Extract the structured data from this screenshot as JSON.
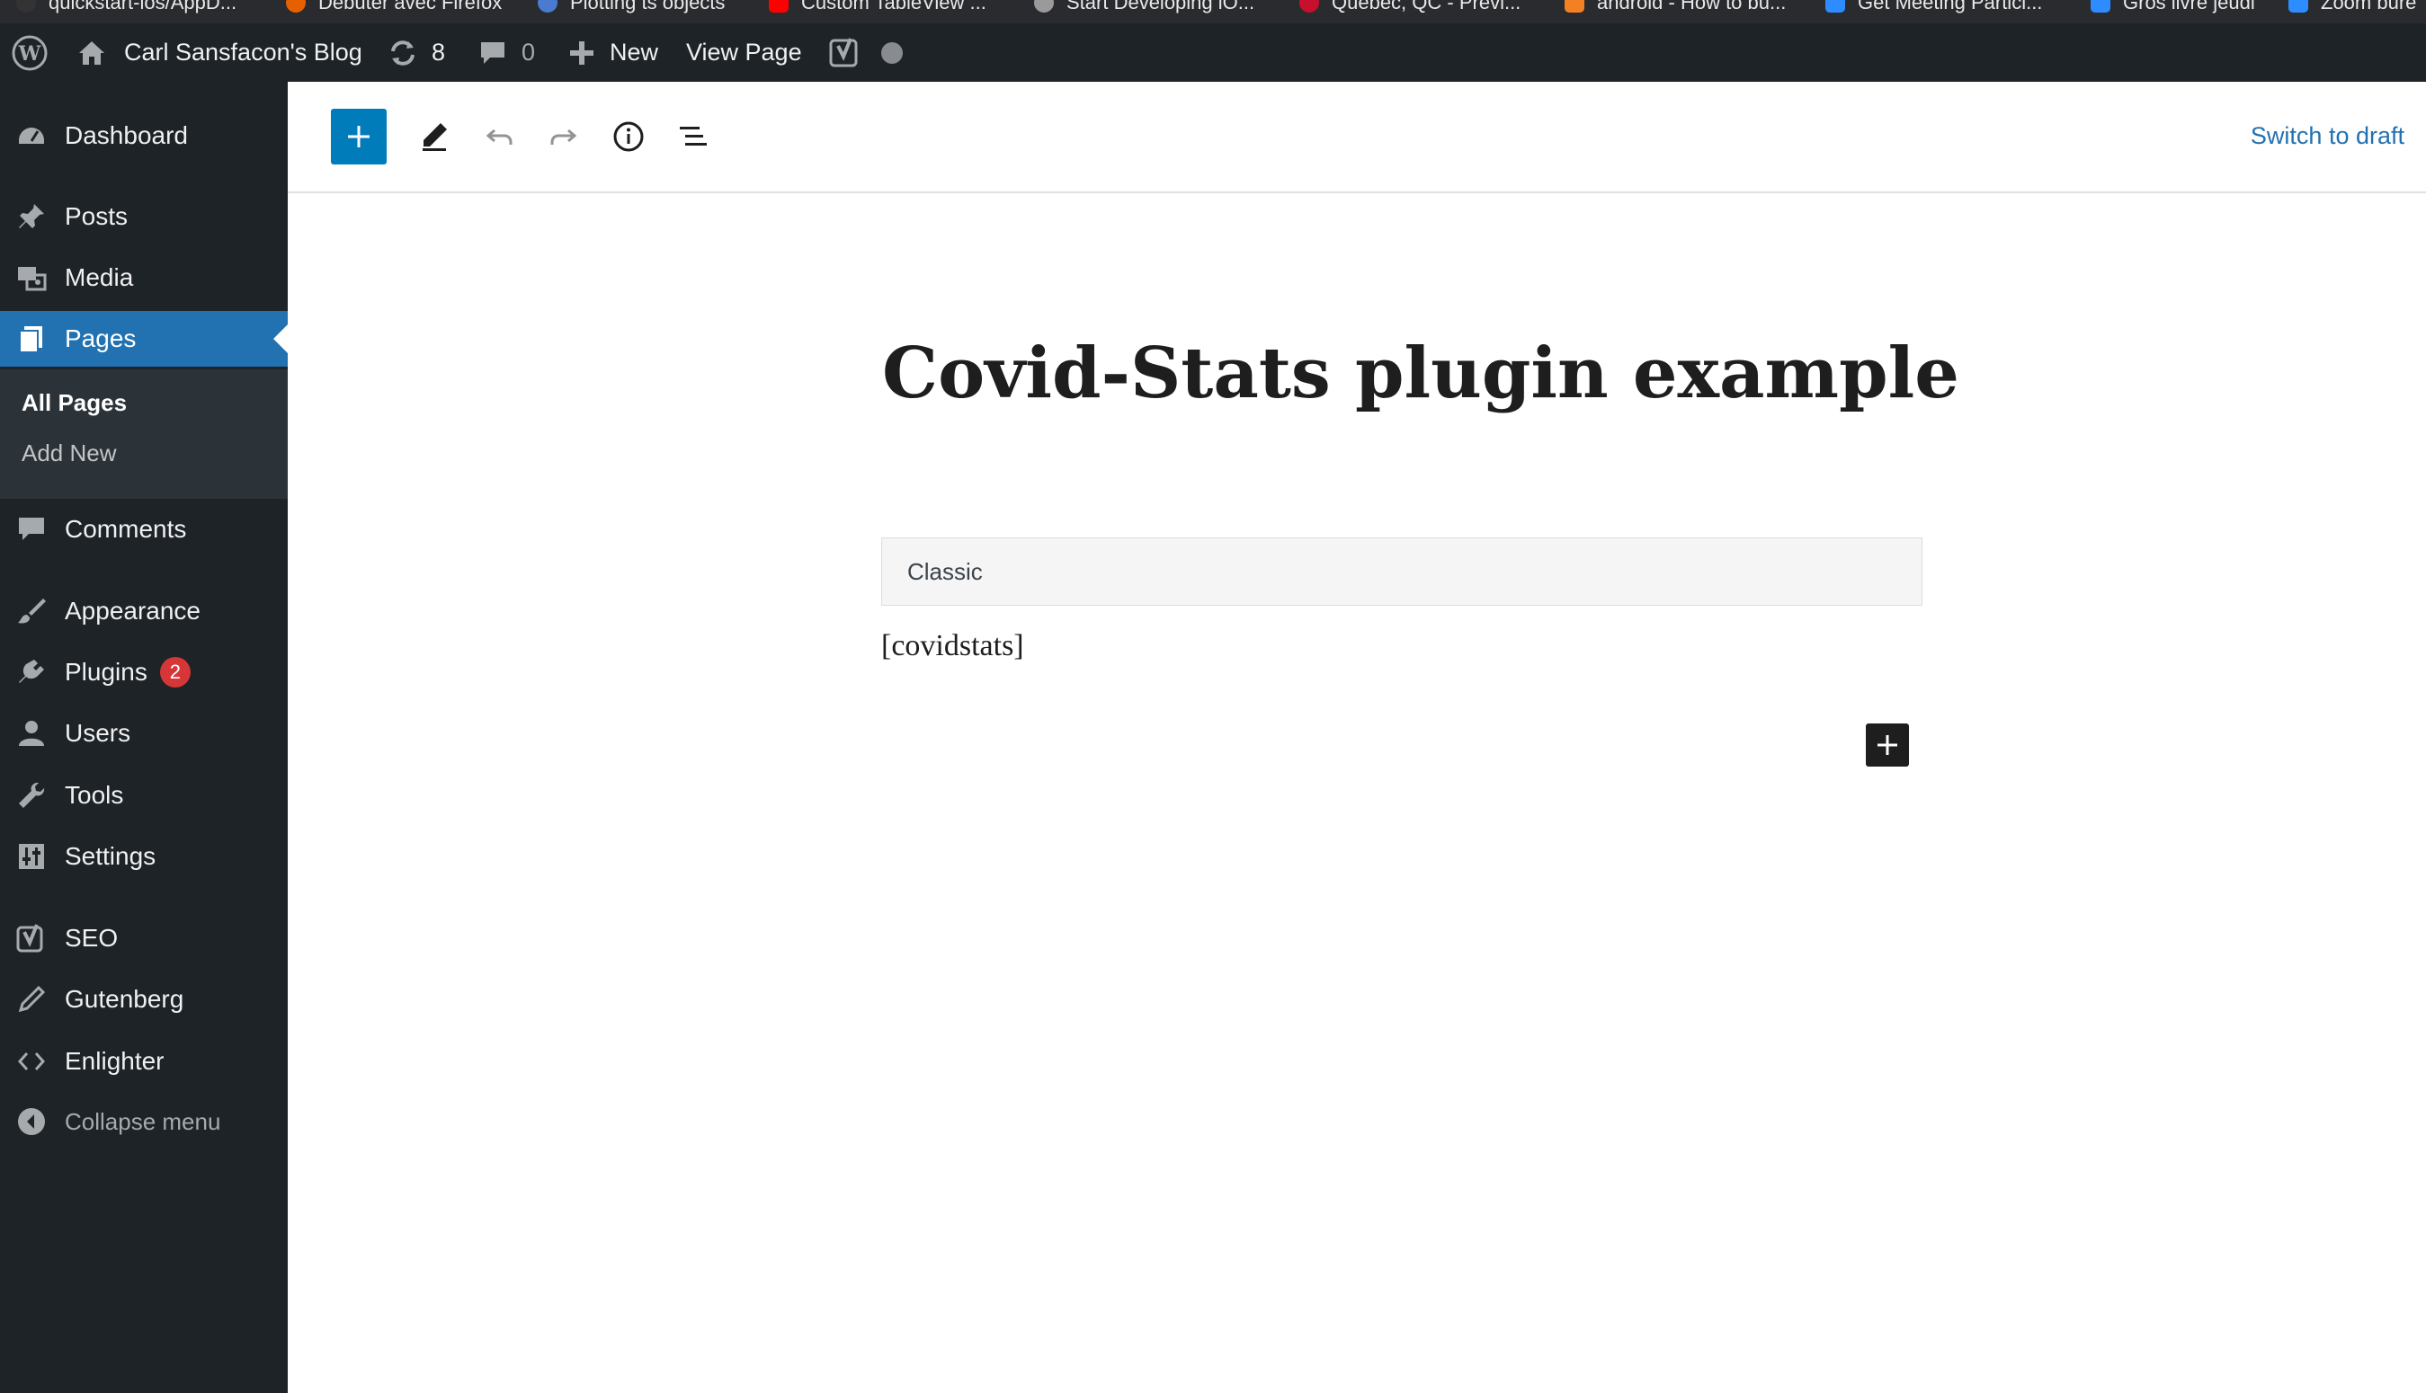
{
  "browser": {
    "bookmarks": [
      {
        "label": "quickstart-ios/AppD...",
        "icon": "github-icon",
        "color": "#333333"
      },
      {
        "label": "Débuter avec Firefox",
        "icon": "firefox-icon",
        "color": "#e66000"
      },
      {
        "label": "Plotting ts objects",
        "icon": "rstudio-icon",
        "color": "#4a7bd0"
      },
      {
        "label": "Custom TableView ...",
        "icon": "youtube-icon",
        "color": "#ff0000"
      },
      {
        "label": "Start Developing iO...",
        "icon": "apple-icon",
        "color": "#9a9a9a"
      },
      {
        "label": "Québec, QC - Prévi...",
        "icon": "weather-icon",
        "color": "#c8102e"
      },
      {
        "label": "android - How to bu...",
        "icon": "stackoverflow-icon",
        "color": "#f48024"
      },
      {
        "label": "Get Meeting Partici...",
        "icon": "zoom-icon",
        "color": "#2d8cff"
      },
      {
        "label": "Gros livre jeudi",
        "icon": "zoom-icon",
        "color": "#2d8cff"
      },
      {
        "label": "Zoom bure",
        "icon": "zoom-icon",
        "color": "#2d8cff"
      }
    ]
  },
  "admin_bar": {
    "site_name": "Carl Sansfacon's Blog",
    "updates_count": "8",
    "comments_count": "0",
    "new_label": "New",
    "view_page_label": "View Page"
  },
  "sidebar": {
    "items": [
      {
        "name": "dashboard",
        "label": "Dashboard",
        "icon": "dashboard-icon"
      },
      {
        "name": "posts",
        "label": "Posts",
        "icon": "pin-icon"
      },
      {
        "name": "media",
        "label": "Media",
        "icon": "media-icon"
      },
      {
        "name": "pages",
        "label": "Pages",
        "icon": "pages-icon",
        "active": true
      },
      {
        "name": "comments",
        "label": "Comments",
        "icon": "comment-icon"
      },
      {
        "name": "appearance",
        "label": "Appearance",
        "icon": "paintbrush-icon"
      },
      {
        "name": "plugins",
        "label": "Plugins",
        "icon": "plugin-icon",
        "badge": "2"
      },
      {
        "name": "users",
        "label": "Users",
        "icon": "user-icon"
      },
      {
        "name": "tools",
        "label": "Tools",
        "icon": "wrench-icon"
      },
      {
        "name": "settings",
        "label": "Settings",
        "icon": "settings-icon"
      },
      {
        "name": "seo",
        "label": "SEO",
        "icon": "yoast-icon"
      },
      {
        "name": "gutenberg",
        "label": "Gutenberg",
        "icon": "pencil-icon"
      },
      {
        "name": "enlighter",
        "label": "Enlighter",
        "icon": "code-icon"
      },
      {
        "name": "collapse",
        "label": "Collapse menu",
        "icon": "collapse-icon"
      }
    ],
    "submenu": {
      "all_pages": "All Pages",
      "add_new": "Add New"
    }
  },
  "editor": {
    "switch_to_draft": "Switch to draft",
    "post_title": "Covid-Stats plugin example",
    "classic_block_label": "Classic",
    "shortcode": "[covidstats]"
  },
  "colors": {
    "admin_bg": "#1d2327",
    "accent": "#2271b1",
    "inserter_blue": "#007cba",
    "badge_red": "#d63638"
  }
}
